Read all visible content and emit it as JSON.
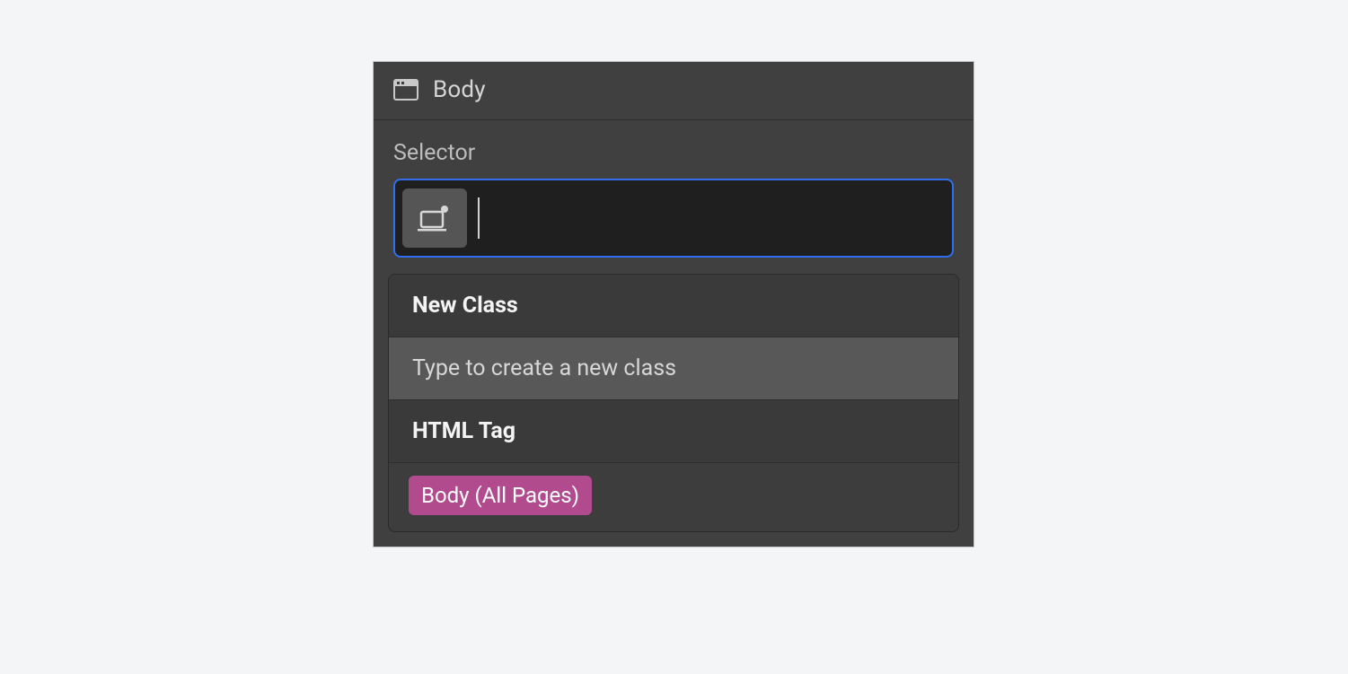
{
  "header": {
    "title": "Body"
  },
  "selector": {
    "label": "Selector",
    "input_value": "",
    "placeholder": ""
  },
  "dropdown": {
    "group_new_class": {
      "heading": "New Class",
      "hint": "Type to create a new class"
    },
    "group_html_tag": {
      "heading": "HTML Tag",
      "tag_label": "Body (All Pages)"
    }
  }
}
